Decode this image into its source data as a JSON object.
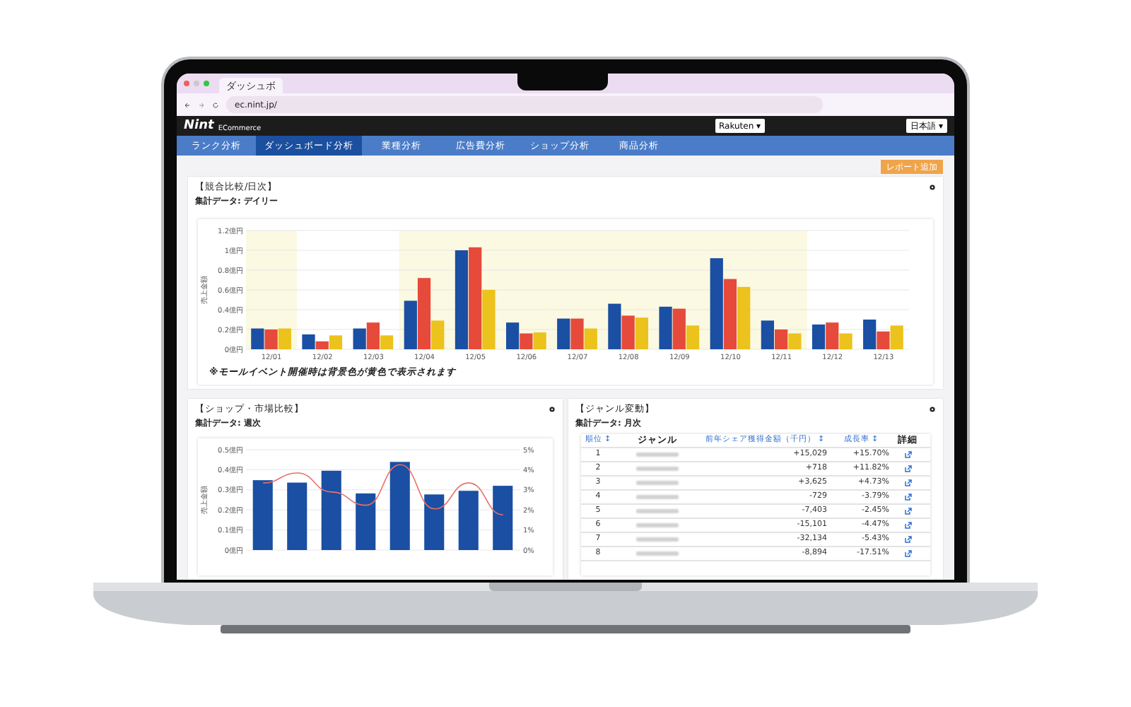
{
  "browser": {
    "tab_title": "ダッシュボ",
    "url": "ec.nint.jp/"
  },
  "header": {
    "logo": "Nint",
    "logo_sub": "ECommerce",
    "mall_select": "Rakuten ▾",
    "language_select": "日本語 ▾"
  },
  "nav": [
    {
      "label": "ランク分析",
      "selected": false
    },
    {
      "label": "ダッシュボード分析",
      "selected": true
    },
    {
      "label": "業種分析",
      "selected": false
    },
    {
      "label": "広告費分析",
      "selected": false
    },
    {
      "label": "ショップ分析",
      "selected": false
    },
    {
      "label": "商品分析",
      "selected": false
    }
  ],
  "report_button": "レポート追加",
  "competitor_card": {
    "title": "【競合比較/日次】",
    "subtitle": "集計データ: デイリー",
    "note": "※モールイベント開催時は背景色が黄色で表示されます",
    "mall_event": [
      true,
      false,
      false,
      true,
      true,
      true,
      true,
      true,
      true,
      true,
      true,
      false,
      false
    ],
    "chart_data": {
      "type": "bar",
      "ylabel": "売上金額",
      "grid": true,
      "categories": [
        "12/01",
        "12/02",
        "12/03",
        "12/04",
        "12/05",
        "12/06",
        "12/07",
        "12/08",
        "12/09",
        "12/10",
        "12/11",
        "12/12",
        "12/13"
      ],
      "series": [
        {
          "color": "#1a4fa3",
          "values": [
            0.21,
            0.15,
            0.21,
            0.49,
            1.0,
            0.27,
            0.31,
            0.46,
            0.43,
            0.92,
            0.29,
            0.25,
            0.3
          ]
        },
        {
          "color": "#e64a3b",
          "values": [
            0.2,
            0.08,
            0.27,
            0.72,
            1.03,
            0.16,
            0.31,
            0.34,
            0.41,
            0.71,
            0.2,
            0.27,
            0.18
          ]
        },
        {
          "color": "#ecc21c",
          "values": [
            0.21,
            0.14,
            0.14,
            0.29,
            0.6,
            0.17,
            0.21,
            0.32,
            0.24,
            0.63,
            0.16,
            0.16,
            0.24
          ]
        }
      ],
      "ylim": [
        0,
        1.2
      ],
      "yticks": [
        {
          "value": 0,
          "label": "0億円"
        },
        {
          "value": 0.2,
          "label": "0.2億円"
        },
        {
          "value": 0.4,
          "label": "0.4億円"
        },
        {
          "value": 0.6,
          "label": "0.6億円"
        },
        {
          "value": 0.8,
          "label": "0.8億円"
        },
        {
          "value": 1.0,
          "label": "1億円"
        },
        {
          "value": 1.2,
          "label": "1.2億円"
        }
      ]
    }
  },
  "shop_card": {
    "title": "【ショップ・市場比較】",
    "subtitle": "集計データ: 週次",
    "right_axis_ticks": [
      "5%",
      "4%",
      "3%",
      "2%",
      "1%",
      "0%"
    ],
    "chart_data": {
      "type": "bar",
      "ylabel": "売上金額",
      "grid": true,
      "series": [
        {
          "type": "bar",
          "color": "#1a4fa3",
          "values": [
            0.348,
            0.336,
            0.395,
            0.282,
            0.439,
            0.277,
            0.295,
            0.32
          ]
        },
        {
          "type": "line",
          "color": "#e8706a",
          "values": [
            0.334,
            0.384,
            0.289,
            0.223,
            0.425,
            0.205,
            0.334,
            0.175
          ]
        }
      ],
      "ylim": [
        0,
        0.5
      ],
      "yticks": [
        {
          "value": 0,
          "label": "0億円"
        },
        {
          "value": 0.1,
          "label": "0.1億円"
        },
        {
          "value": 0.2,
          "label": "0.2億円"
        },
        {
          "value": 0.3,
          "label": "0.3億円"
        },
        {
          "value": 0.4,
          "label": "0.4億円"
        },
        {
          "value": 0.5,
          "label": "0.5億円"
        }
      ]
    }
  },
  "genre_card": {
    "title": "【ジャンル変動】",
    "subtitle": "集計データ: 月次",
    "columns": [
      {
        "label": "順位 ↕",
        "sortable": true
      },
      {
        "label": "ジャンル",
        "sortable": false
      },
      {
        "label": "前年シェア獲得金額（千円） ↕",
        "sortable": true
      },
      {
        "label": "成長率 ↕",
        "sortable": true
      },
      {
        "label": "詳細",
        "sortable": false
      }
    ],
    "rows": [
      {
        "rank": "1",
        "change": "+15,029",
        "growth": "+15.70%"
      },
      {
        "rank": "2",
        "change": "+718",
        "growth": "+11.82%"
      },
      {
        "rank": "3",
        "change": "+3,625",
        "growth": "+4.73%"
      },
      {
        "rank": "4",
        "change": "-729",
        "growth": "-3.79%"
      },
      {
        "rank": "5",
        "change": "-7,403",
        "growth": "-2.45%"
      },
      {
        "rank": "6",
        "change": "-15,101",
        "growth": "-4.47%"
      },
      {
        "rank": "7",
        "change": "-32,134",
        "growth": "-5.43%"
      },
      {
        "rank": "8",
        "change": "-8,894",
        "growth": "-17.51%"
      }
    ]
  }
}
